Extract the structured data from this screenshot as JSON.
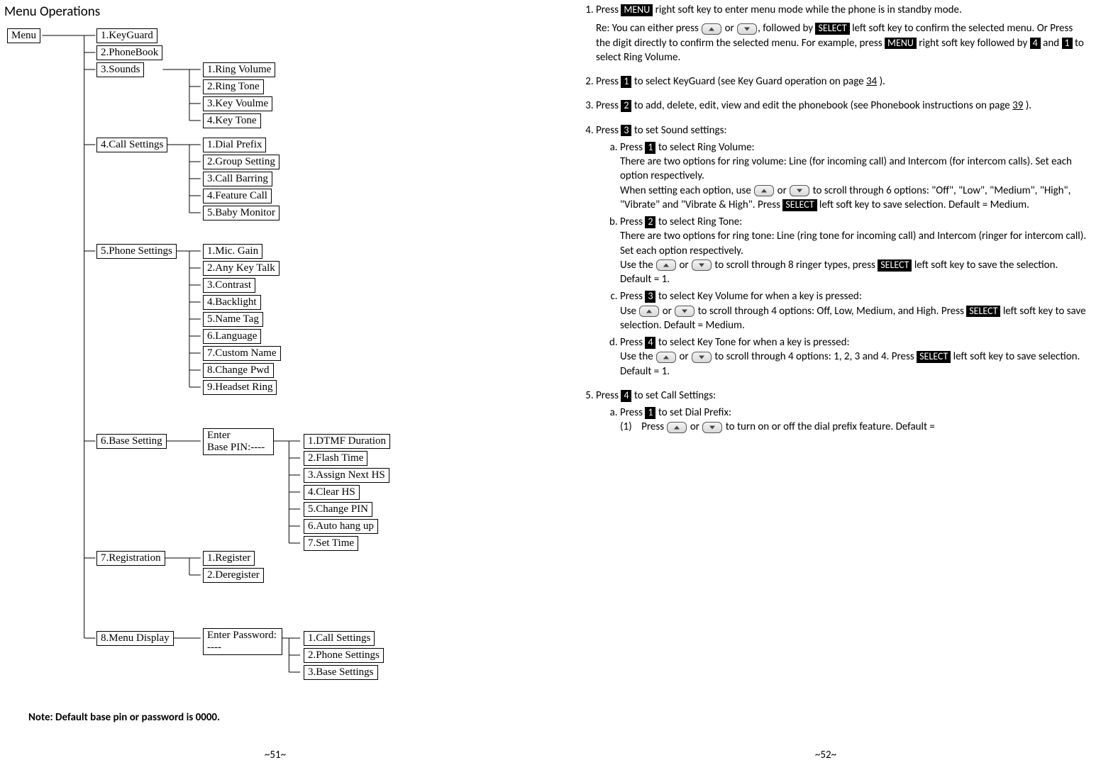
{
  "left": {
    "title": "Menu Operations",
    "root": "Menu",
    "m1": "1.KeyGuard",
    "m2": "2.PhoneBook",
    "m3": "3.Sounds",
    "m3_1": "1.Ring Volume",
    "m3_2": "2.Ring Tone",
    "m3_3": "3.Key Voulme",
    "m3_4": "4.Key Tone",
    "m4": "4.Call Settings",
    "m4_1": "1.Dial Prefix",
    "m4_2": "2.Group Setting",
    "m4_3": "3.Call Barring",
    "m4_4": "4.Feature Call",
    "m4_5": "5.Baby Monitor",
    "m5": "5.Phone Settings",
    "m5_1": "1.Mic. Gain",
    "m5_2": "2.Any Key Talk",
    "m5_3": "3.Contrast",
    "m5_4": "4.Backlight",
    "m5_5": "5.Name Tag",
    "m5_6": "6.Language",
    "m5_7": "7.Custom  Name",
    "m5_8": "8.Change Pwd",
    "m5_9": "9.Headset Ring",
    "m6": "6.Base Setting",
    "m6_pin": "Enter\nBase PIN:----",
    "m6_1": "1.DTMF Duration",
    "m6_2": "2.Flash Time",
    "m6_3": "3.Assign Next HS",
    "m6_4": "4.Clear HS",
    "m6_5": "5.Change PIN",
    "m6_6": "6.Auto hang up",
    "m6_7": "7.Set Time",
    "m7": "7.Registration",
    "m7_1": "1.Register",
    "m7_2": "2.Deregister",
    "m8": "8.Menu Display",
    "m8_pw": "Enter Password:\n----",
    "m8_1": "1.Call Settings",
    "m8_2": "2.Phone Settings",
    "m8_3": "3.Base Settings",
    "note": "Note:  Default base pin or password is 0000.",
    "footer": "~51~"
  },
  "right": {
    "li1a": "Press ",
    "li1_menu": "MENU",
    "li1b": " right soft key to enter menu mode while the phone is in standby mode.",
    "re_prefix": "Re: You can either press ",
    "re_or": " or ",
    "re_after_btns": ", followed by ",
    "re_select": "SELECT",
    "re_after_select": " left soft key to confirm the selected menu. Or Press the digit directly to confirm the selected menu. For example, press ",
    "re_menu2": "MENU",
    "re_after_menu2": " right soft key followed by ",
    "re_k4": " 4 ",
    "re_and": " and ",
    "re_k1": " 1 ",
    "re_tail": " to select Ring Volume.",
    "li2a": "Press ",
    "li2_k1": " 1 ",
    "li2b": " to select KeyGuard (see Key Guard operation on page  ",
    "li2_pg": "34",
    "li2c": " ).",
    "li3a": "Press ",
    "li3_k2": " 2 ",
    "li3b": " to add, delete, edit, view and edit the phonebook (see Phonebook instructions on page  ",
    "li3_pg": "39",
    "li3c": " ).",
    "li4a": "Press ",
    "li4_k3": " 3 ",
    "li4b": " to set Sound settings:",
    "s4a_a": "Press ",
    "s4a_k1": " 1 ",
    "s4a_b": " to select Ring Volume:",
    "s4a_p1": "There are two options for ring volume: Line (for incoming call) and Intercom (for intercom calls). Set each option respectively.",
    "s4a_p2a": "When setting each option, use ",
    "s4a_p2or": " or ",
    "s4a_p2b": " to scroll through 6 options: \"Off\", \"Low\", \"Medium\", \"High\", \"Vibrate\" and \"Vibrate & High\".  Press ",
    "s4a_select": "SELECT",
    "s4a_p2c": " left soft key to save selection.  Default = Medium.",
    "s4b_a": "Press ",
    "s4b_k2": " 2 ",
    "s4b_b": " to select Ring Tone:",
    "s4b_p1": "There are two options for ring tone: Line (ring tone for incoming call) and Intercom (ringer for intercom call). Set each option respectively.",
    "s4b_p2a": "Use the ",
    "s4b_p2or": " or ",
    "s4b_p2b": "  to scroll through 8 ringer types, press ",
    "s4b_select": "SELECT",
    "s4b_p2c": " left soft key to save the selection.  Default = 1.",
    "s4c_a": "Press ",
    "s4c_k3": " 3 ",
    "s4c_b": " to select Key Volume for when a key is pressed:",
    "s4c_p1a": "Use ",
    "s4c_p1or": " or ",
    "s4c_p1b": "  to scroll through 4 options: Off, Low, Medium, and High. Press ",
    "s4c_select": "SELECT",
    "s4c_p1c": " left soft key to save selection.  Default = Medium.",
    "s4d_a": "Press ",
    "s4d_k4": " 4 ",
    "s4d_b": " to select Key Tone for when a key is pressed:",
    "s4d_p1a": "Use the ",
    "s4d_p1or": " or ",
    "s4d_p1b": "  to scroll through 4 options: 1, 2, 3 and 4. Press ",
    "s4d_select": "SELECT",
    "s4d_p1c": " left soft key to save selection.  Default = 1.",
    "li5a": "Press ",
    "li5_k4": " 4 ",
    "li5b": " to set Call Settings:",
    "s5a_a": "Press ",
    "s5a_k1": " 1 ",
    "s5a_b": " to set Dial Prefix:",
    "s5a_num": "(1)",
    "s5a_p1a": "Press  ",
    "s5a_p1or": " or ",
    "s5a_p1b": "  to turn on or off the dial prefix feature.  Default = ",
    "footer": "~52~"
  }
}
